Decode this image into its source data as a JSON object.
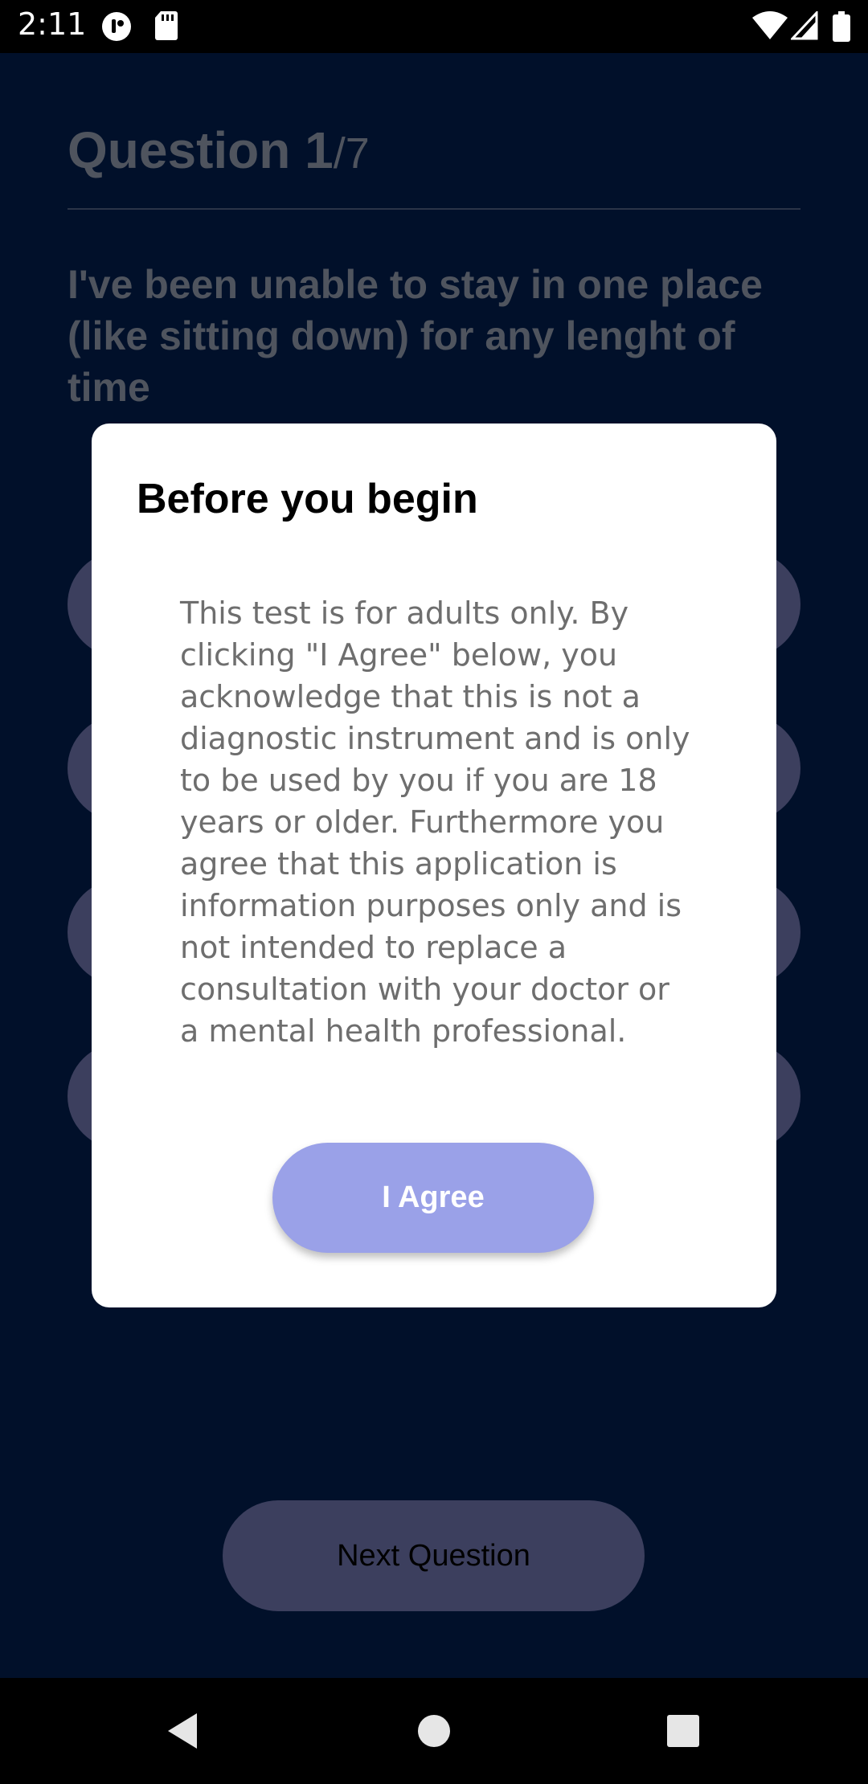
{
  "status_bar": {
    "time": "2:11",
    "icons": [
      "app-notification-icon",
      "sd-card-icon",
      "wifi-icon",
      "signal-icon",
      "battery-icon"
    ]
  },
  "question": {
    "heading": "Question 1",
    "total": "/7",
    "text": "I've been unable to stay in one place (like sitting down) for any lenght of time"
  },
  "next_button": {
    "label": "Next Question"
  },
  "dialog": {
    "title": "Before you begin",
    "body": "This test is for adults only. By clicking \"I Agree\" below, you acknowledge that this is not a diagnostic instrument and is only to be used by you if you are 18 years or older. Furthermore you agree that this application is information purposes only and is not intended to replace a consultation with your doctor or a mental health professional.",
    "agree_label": "I Agree"
  },
  "nav_bar": {
    "icons": [
      "back-icon",
      "home-icon",
      "recents-icon"
    ]
  },
  "colors": {
    "background": "#01102a",
    "accent": "#9aa1e8",
    "option_fill": "#3c3f5e",
    "dim_text": "#4f545e"
  }
}
